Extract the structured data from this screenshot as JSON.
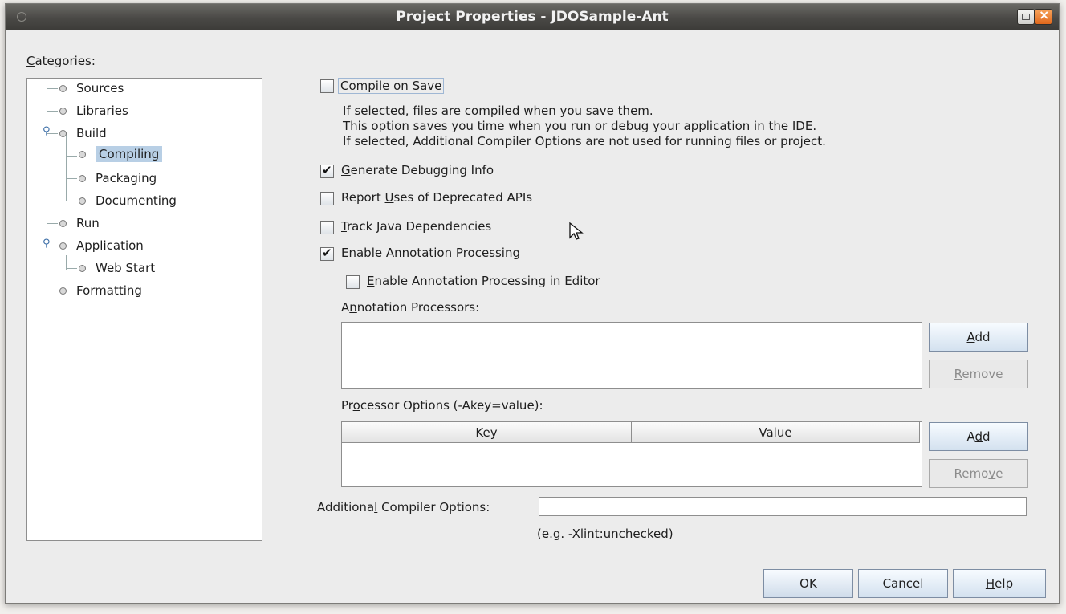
{
  "window": {
    "title": "Project Properties - JDOSample-Ant"
  },
  "categories": {
    "label_prefix": "",
    "label_mnemonic": "C",
    "label_rest": "ategories:",
    "items": [
      {
        "label": "Sources",
        "level": 0
      },
      {
        "label": "Libraries",
        "level": 0
      },
      {
        "label": "Build",
        "level": 0
      },
      {
        "label": "Compiling",
        "level": 1
      },
      {
        "label": "Packaging",
        "level": 1
      },
      {
        "label": "Documenting",
        "level": 1
      },
      {
        "label": "Run",
        "level": 0
      },
      {
        "label": "Application",
        "level": 0
      },
      {
        "label": "Web Start",
        "level": 1
      },
      {
        "label": "Formatting",
        "level": 0
      }
    ],
    "selected": "Compiling"
  },
  "compile_on_save": {
    "label_prefix": "Compile on ",
    "label_mnemonic": "S",
    "label_rest": "ave",
    "checked": false,
    "desc1": "If selected, files are compiled when you save them.",
    "desc2": "This option saves you time when you run or debug your application in the IDE.",
    "desc3": "If selected, Additional Compiler Options are not used for running files or project."
  },
  "debug_info": {
    "label_prefix": "",
    "label_mnemonic": "G",
    "label_rest": "enerate Debugging Info",
    "checked": true
  },
  "deprecated": {
    "label_prefix": "Report ",
    "label_mnemonic": "U",
    "label_rest": "ses of Deprecated APIs",
    "checked": false
  },
  "track_deps": {
    "label_prefix": "",
    "label_mnemonic": "T",
    "label_rest": "rack Java Dependencies",
    "checked": false
  },
  "annotation": {
    "label_prefix": "Enable Annotation ",
    "label_mnemonic": "P",
    "label_rest": "rocessing",
    "checked": true
  },
  "annotation_editor": {
    "label_prefix": "",
    "label_mnemonic": "E",
    "label_rest": "nable Annotation Processing in Editor",
    "checked": false
  },
  "processors": {
    "label_prefix": "A",
    "label_mnemonic": "n",
    "label_rest": "notation Processors:",
    "add": {
      "prefix": "",
      "mnemonic": "A",
      "rest": "dd"
    },
    "remove": {
      "prefix": "",
      "mnemonic": "R",
      "rest": "emove"
    }
  },
  "processor_options": {
    "label_prefix": "Pr",
    "label_mnemonic": "o",
    "label_rest": "cessor Options (-Akey=value):",
    "col_key": "Key",
    "col_value": "Value",
    "add": {
      "prefix": "A",
      "mnemonic": "d",
      "rest": "d"
    },
    "remove": {
      "prefix": "Remo",
      "mnemonic": "v",
      "rest": "e"
    }
  },
  "compiler_options": {
    "label_prefix": "Additiona",
    "label_mnemonic": "l",
    "label_rest": " Compiler Options:",
    "value": "",
    "hint": "(e.g. -Xlint:unchecked)"
  },
  "footer": {
    "ok": "OK",
    "cancel": "Cancel",
    "help": {
      "prefix": "",
      "mnemonic": "H",
      "rest": "elp"
    }
  }
}
